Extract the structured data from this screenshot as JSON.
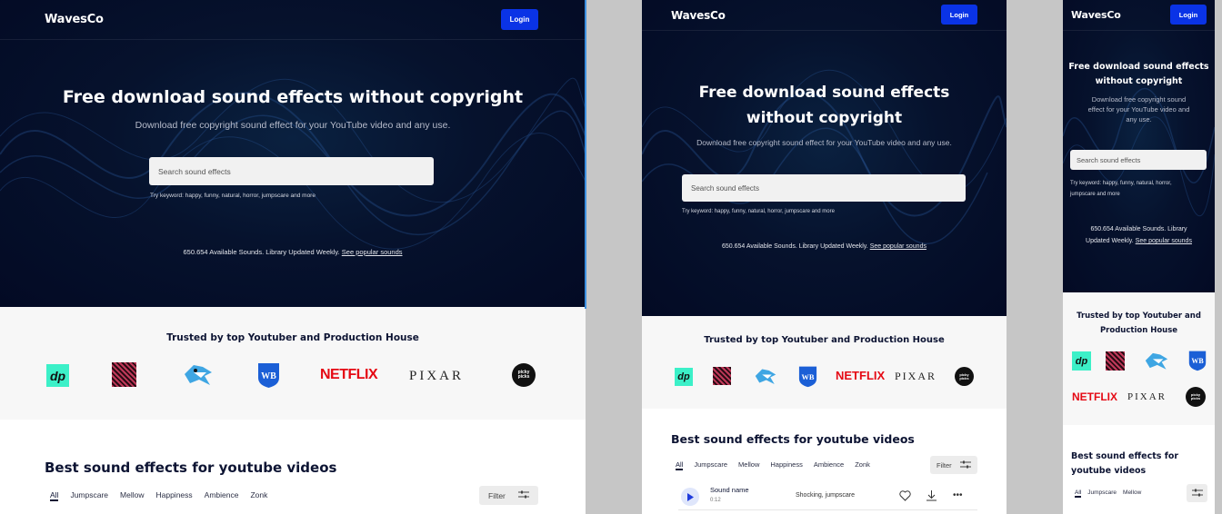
{
  "app": {
    "name": "WavesCo"
  },
  "header": {
    "login_label": "Login"
  },
  "hero": {
    "title": "Free download sound effects without copyright",
    "title_line1": "Free download sound effects",
    "title_line2": "without copyright",
    "subtitle": "Download free copyright sound effect for your YouTube video and any use.",
    "sub_m1": "Download free copyright sound",
    "sub_m2": "effect for your YouTube video and",
    "sub_m3": "any use."
  },
  "search": {
    "placeholder": "Search sound effects",
    "hint": "Try keyword: happy, funny, natural, horror, jumpscare and more",
    "hint_m1": "Try keyword: happy, funny, natural, horror,",
    "hint_m2": "jumpscare and more"
  },
  "stats": {
    "text": "650.654 Available Sounds. Library Updated Weekly.",
    "line1": "650.654 Available Sounds. Library",
    "line2": "Updated Weekly.",
    "link": "See popular sounds"
  },
  "trusted": {
    "title": "Trusted by top Youtuber and Production House",
    "title_m1": "Trusted by top Youtuber and",
    "title_m2": "Production House",
    "logos": {
      "dp": "dp",
      "netflix": "NETFLIX",
      "pixar": "PIXAR",
      "pixar_alt": "P☆XAR",
      "wb": "WB",
      "picky": "picky picks"
    }
  },
  "best": {
    "title": "Best sound effects for youtube videos",
    "title_m1": "Best sound effects for",
    "title_m2": "youtube videos",
    "tabs": [
      "All",
      "Jumpscare",
      "Mellow",
      "Happiness",
      "Ambience",
      "Zonk"
    ],
    "filter_label": "Filter"
  },
  "sound_row": {
    "name": "Sound name",
    "duration": "0:12",
    "tags": "Shocking, jumpscare"
  },
  "colors": {
    "accent": "#0a33e6",
    "hero_bg": "#030a24",
    "netflix": "#e50914",
    "dp": "#3cf0c8"
  },
  "icons": [
    "play-icon",
    "heart-icon",
    "download-icon",
    "more-icon",
    "filter-sliders-icon"
  ]
}
